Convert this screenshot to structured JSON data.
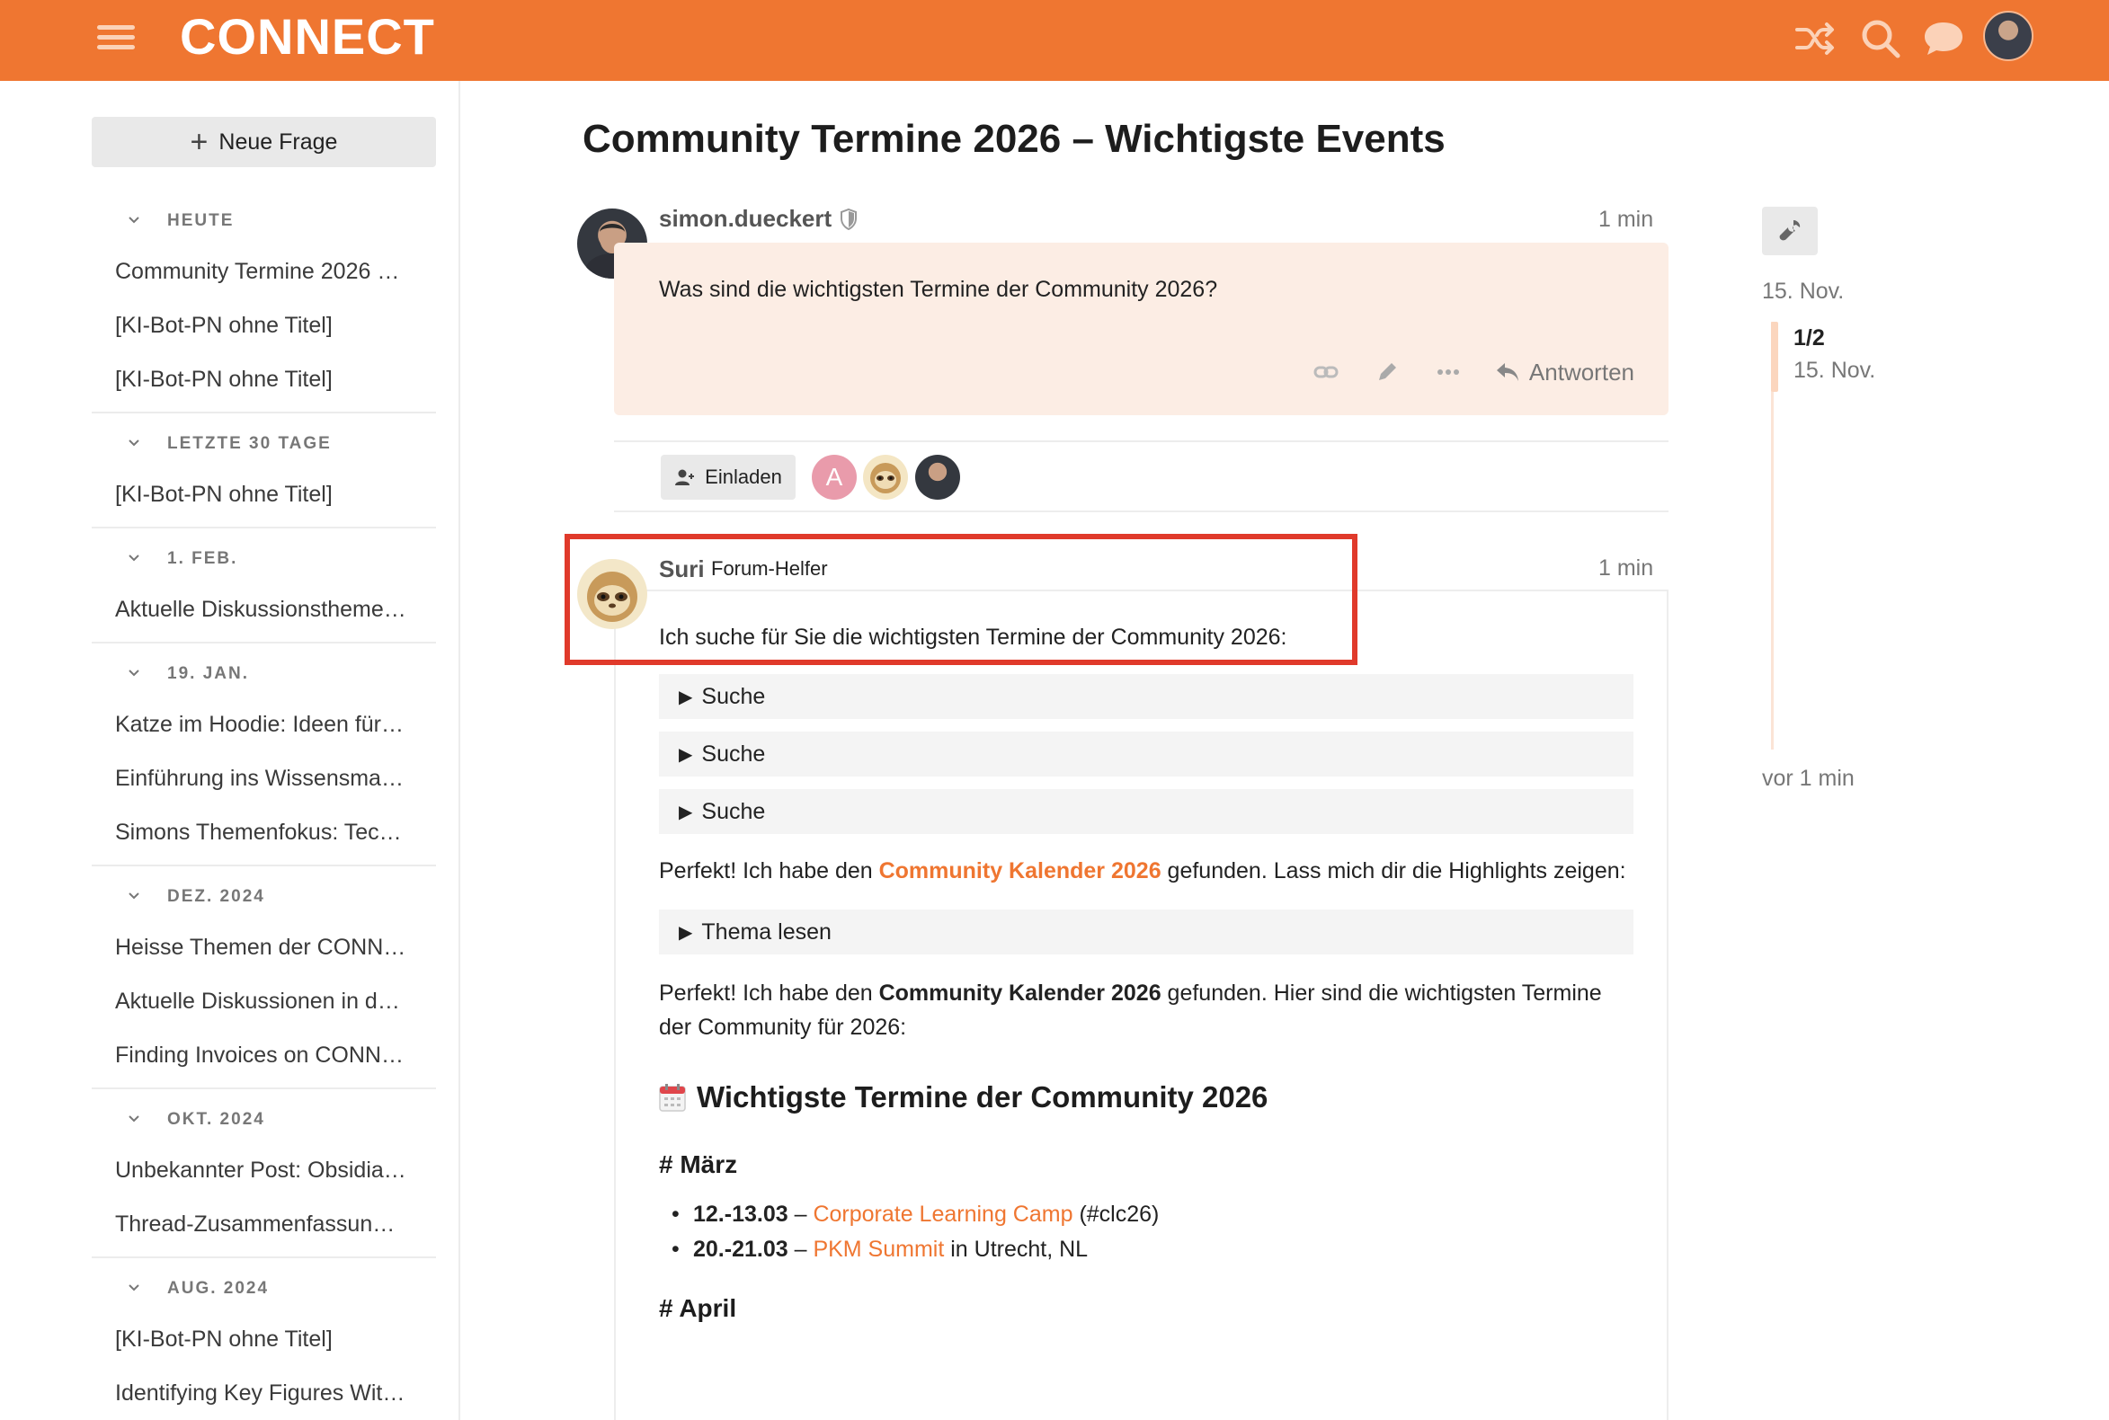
{
  "header": {
    "logo": "CONNECT",
    "icons": [
      "hamburger-icon",
      "shuffle-icon",
      "search-icon",
      "chat-icon",
      "user-avatar"
    ],
    "accent_color": "#ef7631"
  },
  "sidebar": {
    "new_question_label": "Neue Frage",
    "sections": [
      {
        "heading": "HEUTE",
        "items": [
          "Community Termine 2026 …",
          "[KI-Bot-PN ohne Titel]",
          "[KI-Bot-PN ohne Titel]"
        ]
      },
      {
        "heading": "LETZTE 30 TAGE",
        "items": [
          "[KI-Bot-PN ohne Titel]"
        ]
      },
      {
        "heading": "1. FEB.",
        "items": [
          "Aktuelle Diskussionstheme…"
        ]
      },
      {
        "heading": "19. JAN.",
        "items": [
          "Katze im Hoodie: Ideen für…",
          "Einführung ins Wissensma…",
          "Simons Themenfokus: Tec…"
        ]
      },
      {
        "heading": "DEZ. 2024",
        "items": [
          "Heisse Themen der CONN…",
          "Aktuelle Diskussionen in d…",
          "Finding Invoices on CONN…"
        ]
      },
      {
        "heading": "OKT. 2024",
        "items": [
          "Unbekannter Post: Obsidia…",
          "Thread-Zusammenfassun…"
        ]
      },
      {
        "heading": "AUG. 2024",
        "items": [
          "[KI-Bot-PN ohne Titel]",
          "Identifying Key Figures Wit…"
        ]
      }
    ]
  },
  "topic": {
    "title": "Community Termine 2026 – Wichtigste Events"
  },
  "post1": {
    "author": "simon.dueckert",
    "time": "1 min",
    "text": "Was sind die wichtigsten Termine der Community 2026?",
    "reply_label": "Antworten"
  },
  "participants": {
    "invite_label": "Einladen",
    "letter_avatar": "A"
  },
  "post2": {
    "author": "Suri",
    "user_title": "Forum-Helfer",
    "time": "1 min",
    "intro": "Ich suche für Sie die wichtigsten Termine der Community 2026:",
    "details": [
      "Suche",
      "Suche",
      "Suche"
    ],
    "found_1_before": "Perfekt! Ich habe den ",
    "found_1_link": "Community Kalender 2026",
    "found_1_after": " gefunden. Lass mich dir die Highlights zeigen:",
    "read_topic_label": "Thema lesen",
    "found_2_before": "Perfekt! Ich habe den ",
    "found_2_bold": "Community Kalender 2026",
    "found_2_after": " gefunden. Hier sind die wichtigsten Termine der Community für 2026:",
    "heading": "Wichtigste Termine der Community 2026",
    "month_march": "# März",
    "events_march": [
      {
        "date": "12.-13.03",
        "sep": " – ",
        "link": "Corporate Learning Camp",
        "suffix": " (#clc26)"
      },
      {
        "date": "20.-21.03",
        "sep": " – ",
        "link": "PKM Summit",
        "suffix": " in Utrecht, NL"
      }
    ],
    "month_april": "# April"
  },
  "timeline": {
    "start_date": "15. Nov.",
    "position": "1/2",
    "current_date": "15. Nov.",
    "end_label": "vor 1 min"
  }
}
